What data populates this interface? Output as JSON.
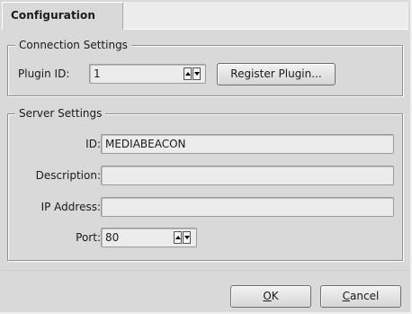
{
  "tab": {
    "label": "Configuration"
  },
  "connection": {
    "title": "Connection Settings",
    "plugin_id_label": "Plugin ID:",
    "plugin_id_value": "1",
    "register_button": "Register Plugin..."
  },
  "server": {
    "title": "Server Settings",
    "id_label": "ID:",
    "id_value": "MEDIABEACON",
    "description_label": "Description:",
    "description_value": "",
    "ip_label": "IP Address:",
    "ip_value": "",
    "port_label": "Port:",
    "port_value": "80"
  },
  "footer": {
    "ok_mnemonic": "O",
    "ok_rest": "K",
    "cancel_mnemonic": "C",
    "cancel_rest": "ancel"
  }
}
